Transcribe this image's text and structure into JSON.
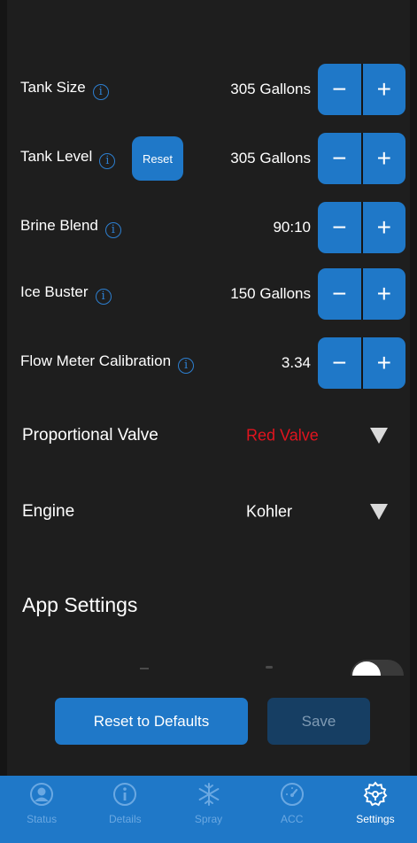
{
  "settings": {
    "tank_size": {
      "label": "Tank Size",
      "value": "305 Gallons"
    },
    "tank_level": {
      "label": "Tank Level",
      "value": "305 Gallons",
      "reset_label": "Reset"
    },
    "brine_blend": {
      "label": "Brine Blend",
      "value": "90:10"
    },
    "ice_buster": {
      "label": "Ice Buster",
      "value": "150 Gallons"
    },
    "flow_meter": {
      "label": "Flow Meter Calibration",
      "value": "3.34"
    },
    "stepper": {
      "minus": "−",
      "plus": "+"
    },
    "info_glyph": "i"
  },
  "dropdowns": {
    "proportional_valve": {
      "label": "Proportional Valve",
      "value": "Red Valve",
      "value_color": "#e0141e"
    },
    "engine": {
      "label": "Engine",
      "value": "Kohler",
      "value_color": "#ffffff"
    }
  },
  "app_settings": {
    "title": "App Settings",
    "toggle_on": true
  },
  "actions": {
    "reset_defaults": "Reset to Defaults",
    "save": "Save"
  },
  "tabbar": {
    "tabs": [
      {
        "label": "Status",
        "icon": "person-circle-icon",
        "active": false
      },
      {
        "label": "Details",
        "icon": "info-circle-icon",
        "active": false
      },
      {
        "label": "Spray",
        "icon": "snowflake-icon",
        "active": false
      },
      {
        "label": "ACC",
        "icon": "speedometer-icon",
        "active": false
      },
      {
        "label": "Settings",
        "icon": "steering-wheel-icon",
        "active": true
      }
    ]
  },
  "colors": {
    "accent": "#1f78c8",
    "background": "#1e1e1e",
    "warning": "#e0141e"
  }
}
